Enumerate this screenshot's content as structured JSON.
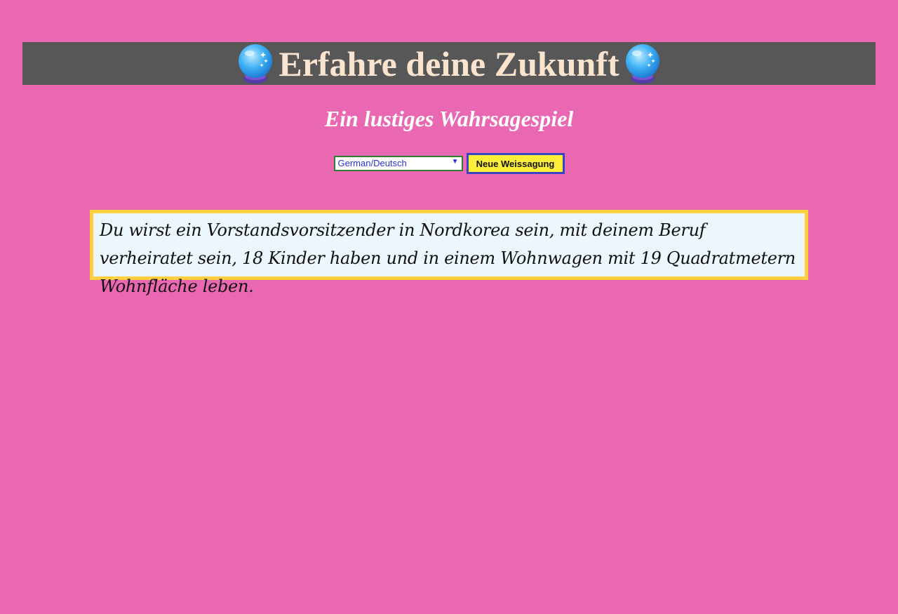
{
  "header": {
    "title": "Erfahre deine Zukunft",
    "left_icon": "crystal-ball-icon",
    "right_icon": "crystal-ball-icon",
    "bar_color": "#575757",
    "title_color": "#fbe4cf"
  },
  "subtitle": "Ein lustiges Wahrsagespiel",
  "controls": {
    "language_selected": "German/Deutsch",
    "new_button_label": "Neue Weissagung"
  },
  "fortune": {
    "text": "Du wirst ein Vorstandsvorsitzender in Nordkorea sein, mit deinem Beruf verheiratet sein, 18 Kinder haben und in einem Wohnwagen mit 19 Quadratmetern Wohnfläche leben."
  },
  "colors": {
    "background": "#ea67b1",
    "button_bg": "#ffee3a",
    "button_border": "#3a45c4",
    "box_border": "#fbcf3e",
    "box_bg": "#ecf6fd"
  }
}
